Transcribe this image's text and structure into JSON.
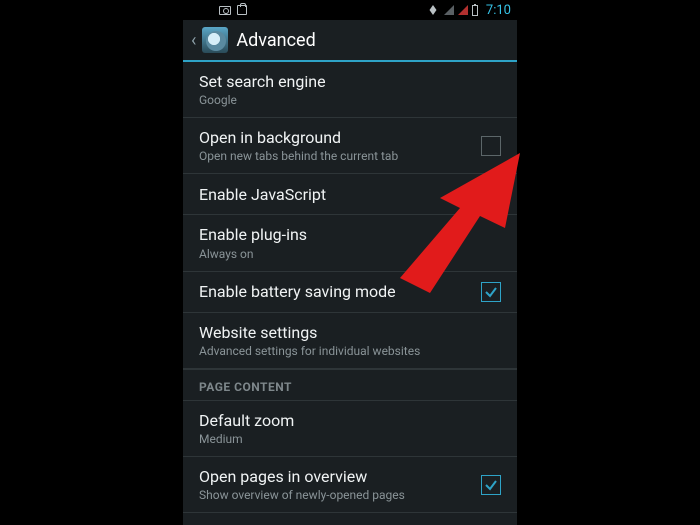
{
  "statusbar": {
    "time": "7:10"
  },
  "header": {
    "title": "Advanced"
  },
  "settings": {
    "search_engine": {
      "title": "Set search engine",
      "value": "Google"
    },
    "open_bg": {
      "title": "Open in background",
      "subtitle": "Open new tabs behind the current tab",
      "checked": false
    },
    "enable_js": {
      "title": "Enable JavaScript",
      "checked": true
    },
    "enable_plugins": {
      "title": "Enable plug-ins",
      "value": "Always on"
    },
    "battery_save": {
      "title": "Enable battery saving mode",
      "checked": true
    },
    "website_settings": {
      "title": "Website settings",
      "subtitle": "Advanced settings for individual websites"
    }
  },
  "section": {
    "page_content": "PAGE CONTENT"
  },
  "page_content": {
    "default_zoom": {
      "title": "Default zoom",
      "value": "Medium"
    },
    "open_overview": {
      "title": "Open pages in overview",
      "subtitle": "Show overview of newly-opened pages",
      "checked": true
    }
  }
}
